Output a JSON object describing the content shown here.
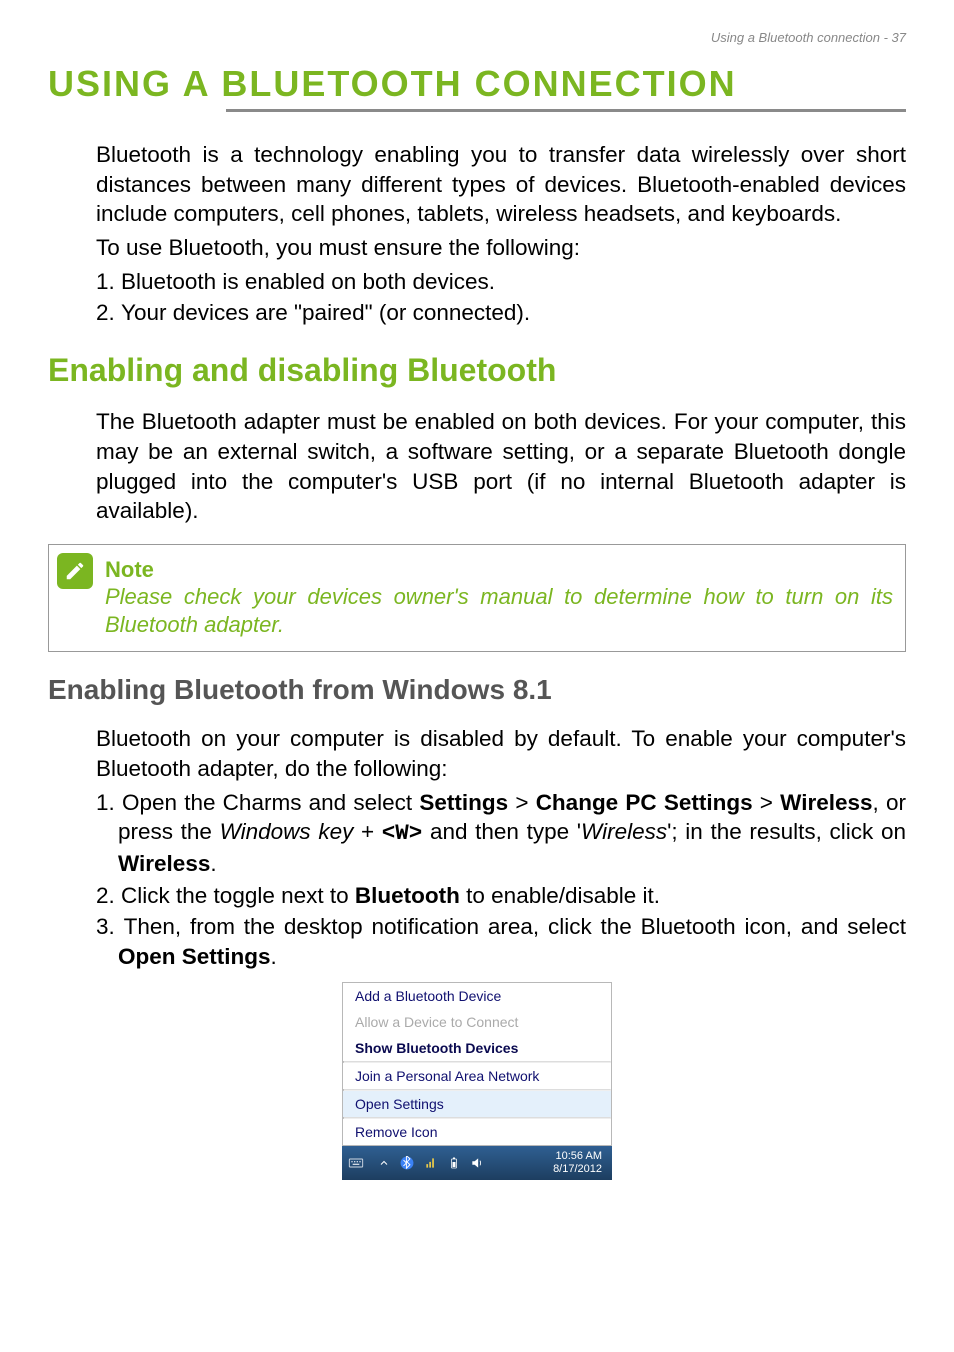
{
  "header": {
    "right": "Using a Bluetooth connection - 37"
  },
  "title": "USING A BLUETOOTH CONNECTION",
  "intro": "Bluetooth is a technology enabling you to transfer data wirelessly over short distances between many different types of devices. Bluetooth-enabled devices include computers, cell phones, tablets, wireless headsets, and keyboards.",
  "ensure_line": "To use Bluetooth, you must ensure the following:",
  "ensure_steps": [
    "Bluetooth is enabled on both devices.",
    "Your devices are \"paired\" (or connected)."
  ],
  "section1": {
    "title": "Enabling and disabling Bluetooth",
    "body": "The Bluetooth adapter must be enabled on both devices. For your computer, this may be an external switch, a software setting, or a separate Bluetooth dongle plugged into the computer's USB port (if no internal Bluetooth adapter is available)."
  },
  "note": {
    "title": "Note",
    "body": "Please check your devices owner's manual to determine how to turn on its Bluetooth adapter."
  },
  "section2": {
    "title": "Enabling Bluetooth from Windows 8.1",
    "intro": "Bluetooth on your computer is disabled by default. To enable your computer's Bluetooth adapter, do the following:",
    "steps": {
      "s1": {
        "pre": "Open the Charms and select ",
        "settings": "Settings",
        "gt1": " > ",
        "change": "Change PC Settings",
        "gt2": " > ",
        "wireless": "Wireless",
        "mid": ", or press the ",
        "winkey": "Windows key",
        "plus": " + ",
        "w": "<W>",
        "tail1": " and then type '",
        "wireless_ital": "Wireless",
        "tail2": "'; in the results, click on ",
        "wireless_b": "Wireless",
        "dot": "."
      },
      "s2": {
        "pre": "Click the toggle next to ",
        "bt": "Bluetooth",
        "post": " to enable/disable it."
      },
      "s3": {
        "pre": "Then, from the desktop notification area, click the Bluetooth icon, and select ",
        "open": "Open Settings",
        "dot": "."
      }
    }
  },
  "menu": {
    "items": [
      "Add a Bluetooth Device",
      "Allow a Device to Connect",
      "Show Bluetooth Devices",
      "Join a Personal Area Network",
      "Open Settings",
      "Remove Icon"
    ],
    "time": "10:56 AM",
    "date": "8/17/2012"
  }
}
